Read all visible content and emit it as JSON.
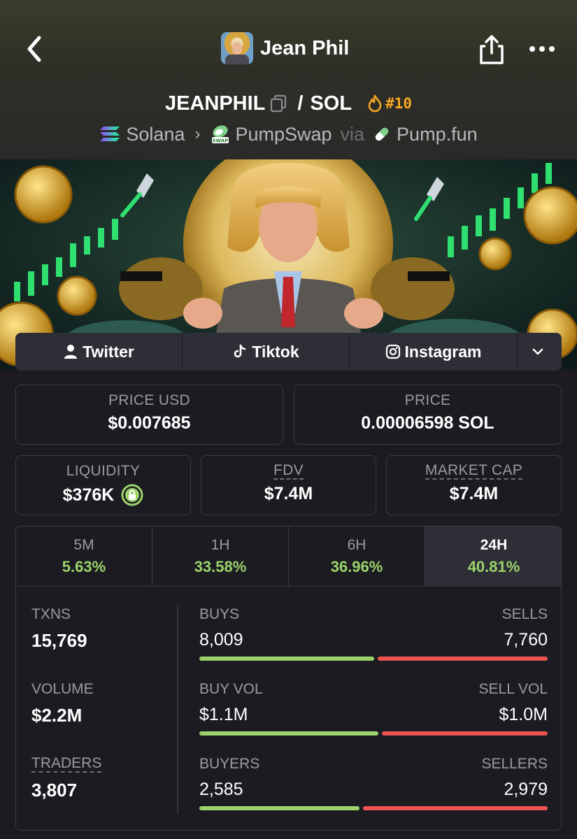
{
  "header": {
    "title": "Jean Phil",
    "pair_base": "JEANPHIL",
    "pair_separator": "/",
    "pair_quote": "SOL",
    "rank": "#10",
    "chain": "Solana",
    "dex": "PumpSwap",
    "via": "via",
    "launchpad": "Pump.fun"
  },
  "socials": {
    "twitter": "Twitter",
    "tiktok": "Tiktok",
    "instagram": "Instagram"
  },
  "prices": {
    "price_usd_label": "PRICE USD",
    "price_usd": "$0.007685",
    "price_label": "PRICE",
    "price_sol": "0.00006598 SOL"
  },
  "metrics": {
    "liquidity_label": "LIQUIDITY",
    "liquidity": "$376K",
    "fdv_label": "FDV",
    "fdv": "$7.4M",
    "mcap_label": "MARKET CAP",
    "mcap": "$7.4M"
  },
  "timeframes": [
    {
      "label": "5M",
      "change": "5.63%"
    },
    {
      "label": "1H",
      "change": "33.58%"
    },
    {
      "label": "6H",
      "change": "36.96%"
    },
    {
      "label": "24H",
      "change": "40.81%"
    }
  ],
  "active_timeframe": "24H",
  "stats": {
    "txns_label": "TXNS",
    "txns": "15,769",
    "volume_label": "VOLUME",
    "volume": "$2.2M",
    "traders_label": "TRADERS",
    "traders": "3,807",
    "buys_label": "BUYS",
    "buys": "8,009",
    "sells_label": "SELLS",
    "sells": "7,760",
    "buy_vol_label": "BUY VOL",
    "buy_vol": "$1.1M",
    "sell_vol_label": "SELL VOL",
    "sell_vol": "$1.0M",
    "buyers_label": "BUYERS",
    "buyers": "2,585",
    "sellers_label": "SELLERS",
    "sellers": "2,979"
  },
  "bar_ratios": {
    "buys_fraction": 0.508,
    "buy_vol_fraction": 0.52,
    "buyers_fraction": 0.465
  },
  "colors": {
    "positive": "#9bd36a",
    "negative": "#ef5350",
    "rank": "#f5a623",
    "background": "#1b1b21"
  },
  "icons": [
    "back-icon",
    "share-icon",
    "more-icon",
    "copy-icon",
    "flame-icon",
    "solana-icon",
    "swap-icon",
    "pill-icon",
    "user-icon",
    "tiktok-icon",
    "instagram-icon",
    "chevron-down-icon",
    "lock-icon"
  ]
}
